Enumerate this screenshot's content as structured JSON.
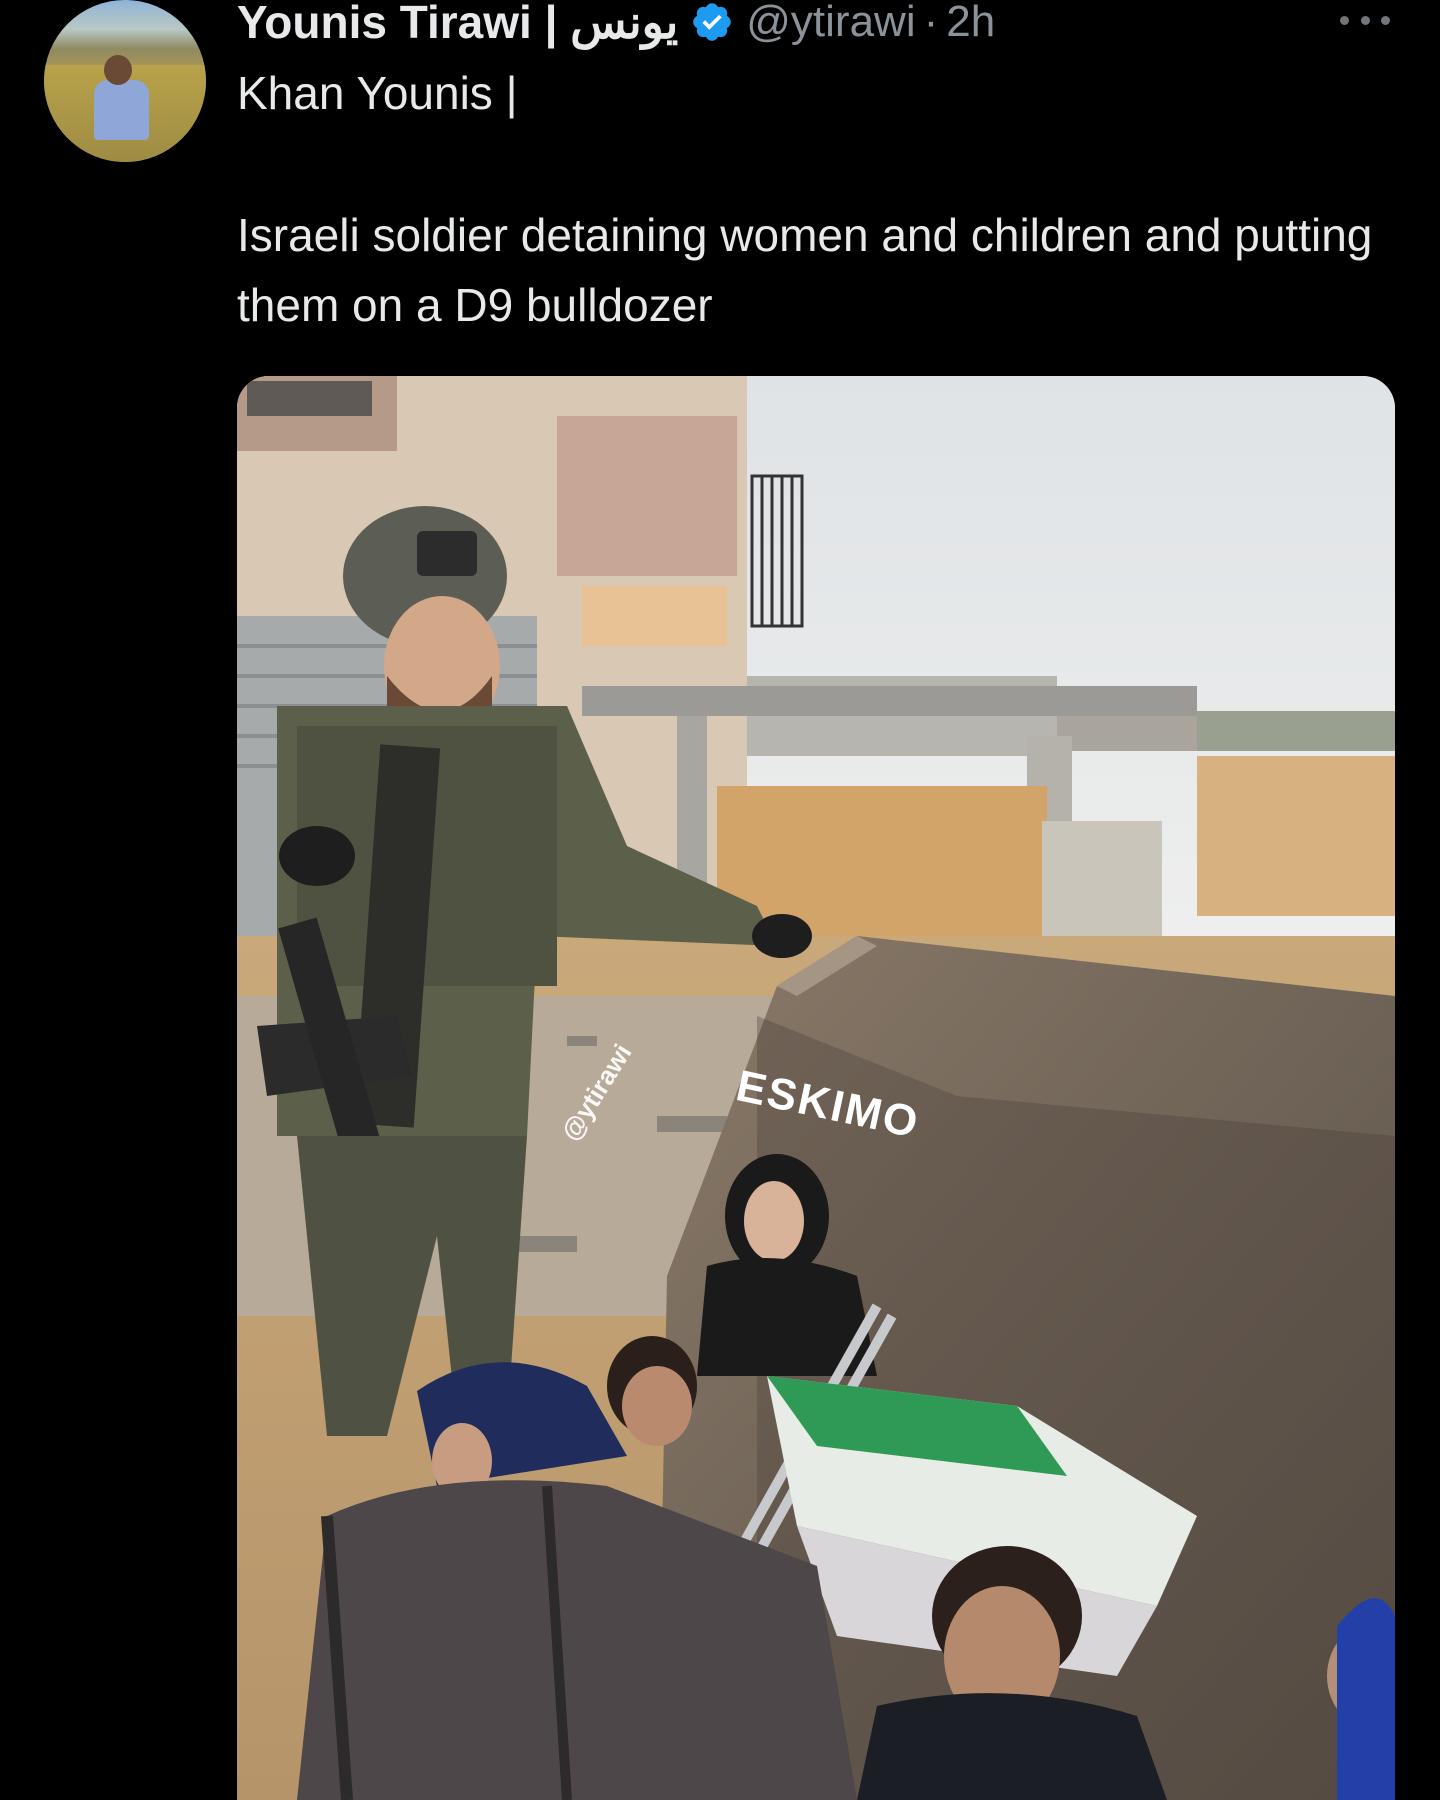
{
  "tweet": {
    "display_name": "Younis Tirawi | يونس",
    "handle": "@ytirawi",
    "separator": "·",
    "time": "2h",
    "location": "Khan Younis |",
    "text": "Israeli soldier detaining women and children and putting them on a D9 bulldozer",
    "more_icon": "more-horizontal-icon",
    "verified_icon": "verified-badge-icon",
    "accent_color": "#1d9bf0"
  },
  "media": {
    "watermark": "@ytirawi",
    "bag_brand": "ESKIMO"
  }
}
